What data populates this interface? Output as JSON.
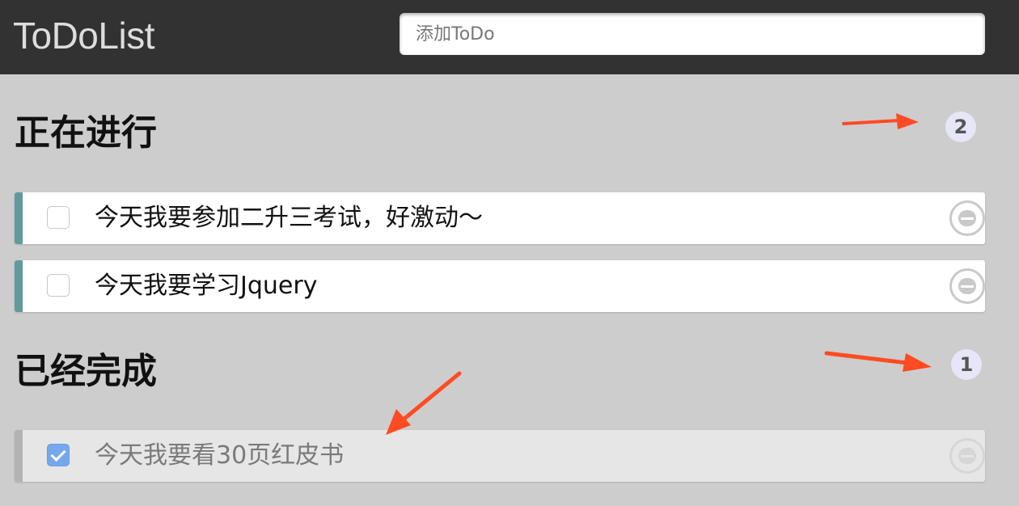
{
  "header": {
    "title": "ToDoList",
    "input_placeholder": "添加ToDo"
  },
  "sections": {
    "todo": {
      "title": "正在进行",
      "count": "2"
    },
    "done": {
      "title": "已经完成",
      "count": "1"
    }
  },
  "todos": [
    {
      "text": "今天我要参加二升三考试，好激动～",
      "checked": false
    },
    {
      "text": "今天我要学习Jquery",
      "checked": false
    }
  ],
  "done": [
    {
      "text": "今天我要看30页红皮书",
      "checked": true
    }
  ],
  "colors": {
    "header_bg": "#323232",
    "page_bg": "#cdcdcd",
    "item_accent": "#629a9c",
    "done_accent": "#b3b3b3",
    "badge_bg": "#e6e6f8",
    "annotation_arrow": "#ff4b23"
  },
  "icons": {
    "delete": "remove-circle-icon",
    "check": "checkmark-icon"
  }
}
